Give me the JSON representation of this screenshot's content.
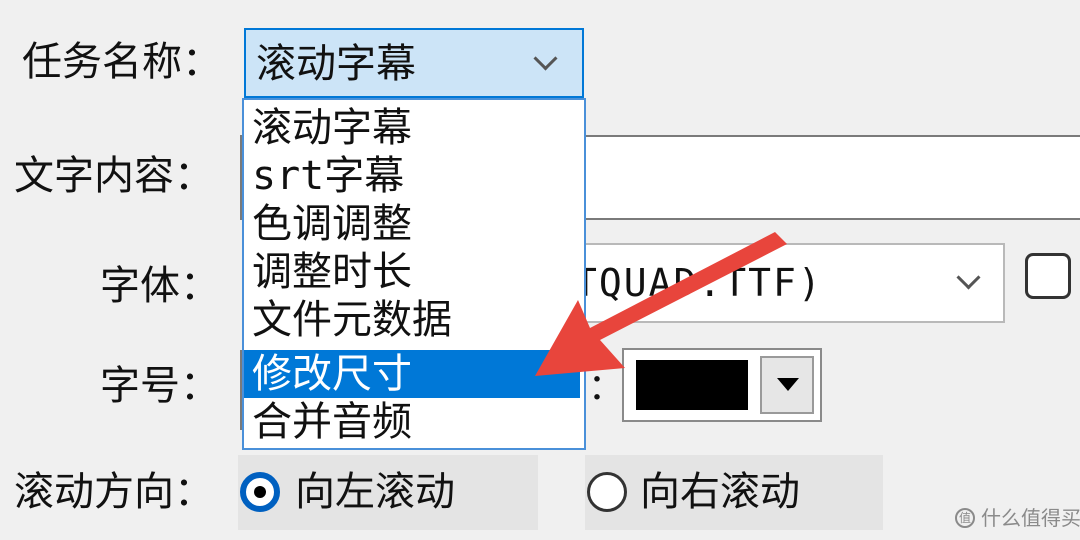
{
  "form": {
    "task_label": "任务名称：",
    "task_value": "滚动字幕",
    "text_label": "文字内容：",
    "text_value": "",
    "font_label": "字体：",
    "font_value": "TQUAD.TTF)",
    "size_label": "字号：",
    "color_label_partial": "：",
    "color_value": "#000000",
    "direction_label": "滚动方向：",
    "direction_left": "向左滚动",
    "direction_right": "向右滚动",
    "direction_selected": "向左滚动"
  },
  "dropdown": {
    "options": [
      "滚动字幕",
      "srt字幕",
      "色调调整",
      "调整时长",
      "文件元数据",
      "修改尺寸",
      "合并音频"
    ],
    "highlighted": "修改尺寸"
  },
  "annotation": {
    "color": "#e8453c"
  },
  "watermark": {
    "text": "什么值得买",
    "icon": "值"
  }
}
